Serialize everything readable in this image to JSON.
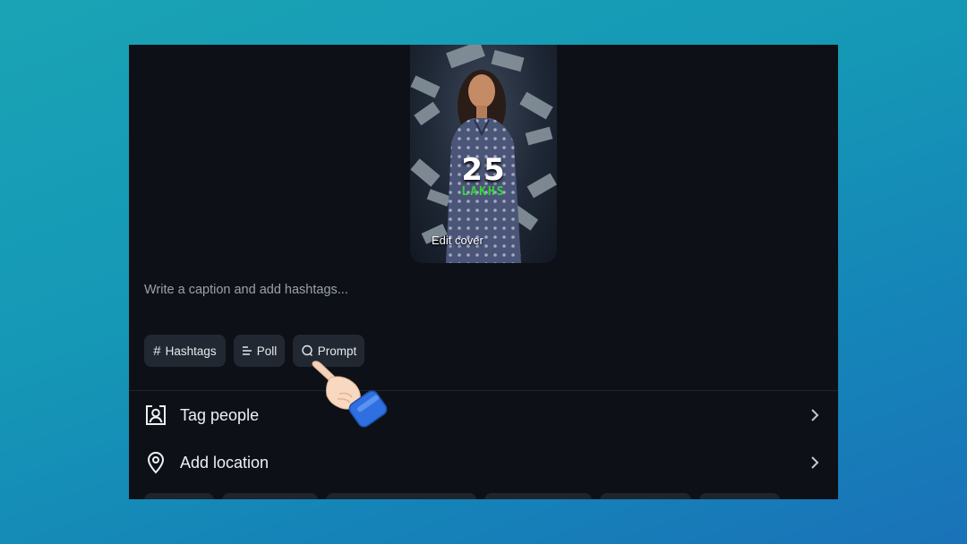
{
  "cover": {
    "headline": "25",
    "subline": "LAKHS",
    "edit_label": "Edit cover"
  },
  "caption": {
    "placeholder": "Write a caption and add hashtags..."
  },
  "chips": [
    {
      "label": "Hashtags",
      "icon": "hash-icon"
    },
    {
      "label": "Poll",
      "icon": "poll-icon"
    },
    {
      "label": "Prompt",
      "icon": "prompt-bubble-icon"
    }
  ],
  "options": [
    {
      "label": "Tag people",
      "icon": "tag-person-icon"
    },
    {
      "label": "Add location",
      "icon": "location-pin-icon"
    }
  ],
  "colors": {
    "page_bg": "#0d1117",
    "chip_bg": "#222831",
    "accent_green": "#36d63c",
    "backdrop": "#1598b6"
  },
  "overlay": {
    "pointer": "pointing-hand-icon"
  }
}
